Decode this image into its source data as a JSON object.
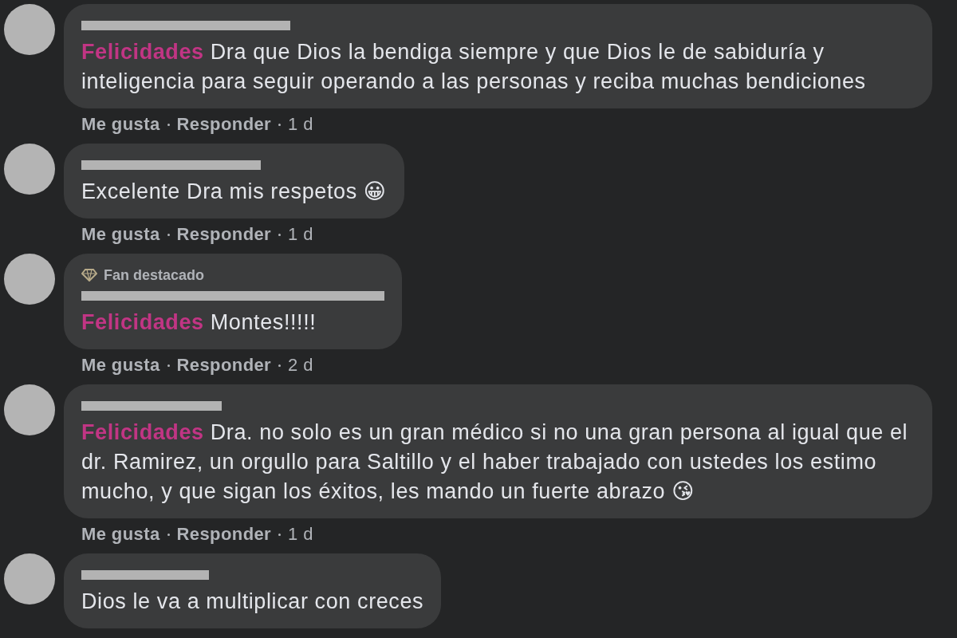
{
  "comments": [
    {
      "name_redacted": true,
      "text": "**Felicidades** Dra que Dios la bendiga siempre y que Dios le de sabiduría y inteligencia para seguir operando a las personas y reciba muchas bendiciones",
      "actions": [
        "Me gusta",
        "Responder"
      ],
      "time": "1 d"
    },
    {
      "name_redacted": true,
      "text": "Excelente Dra mis respetos 😀",
      "actions": [
        "Me gusta",
        "Responder"
      ],
      "time": "1 d"
    },
    {
      "badge": "Fan destacado",
      "name_redacted": true,
      "text": "**Felicidades** Montes!!!!!",
      "actions": [
        "Me gusta",
        "Responder"
      ],
      "time": "2 d"
    },
    {
      "name_redacted": true,
      "text": "**Felicidades** Dra. no solo es un gran médico si no una gran persona al igual que el dr. Ramirez, un orgullo para Saltillo y el haber trabajado con ustedes los estimo mucho, y que sigan los éxitos, les mando un fuerte abrazo 😘",
      "actions": [
        "Me gusta",
        "Responder"
      ],
      "time": "1 d"
    },
    {
      "name_redacted": true,
      "text": "Dios le va a multiplicar con creces"
    }
  ]
}
